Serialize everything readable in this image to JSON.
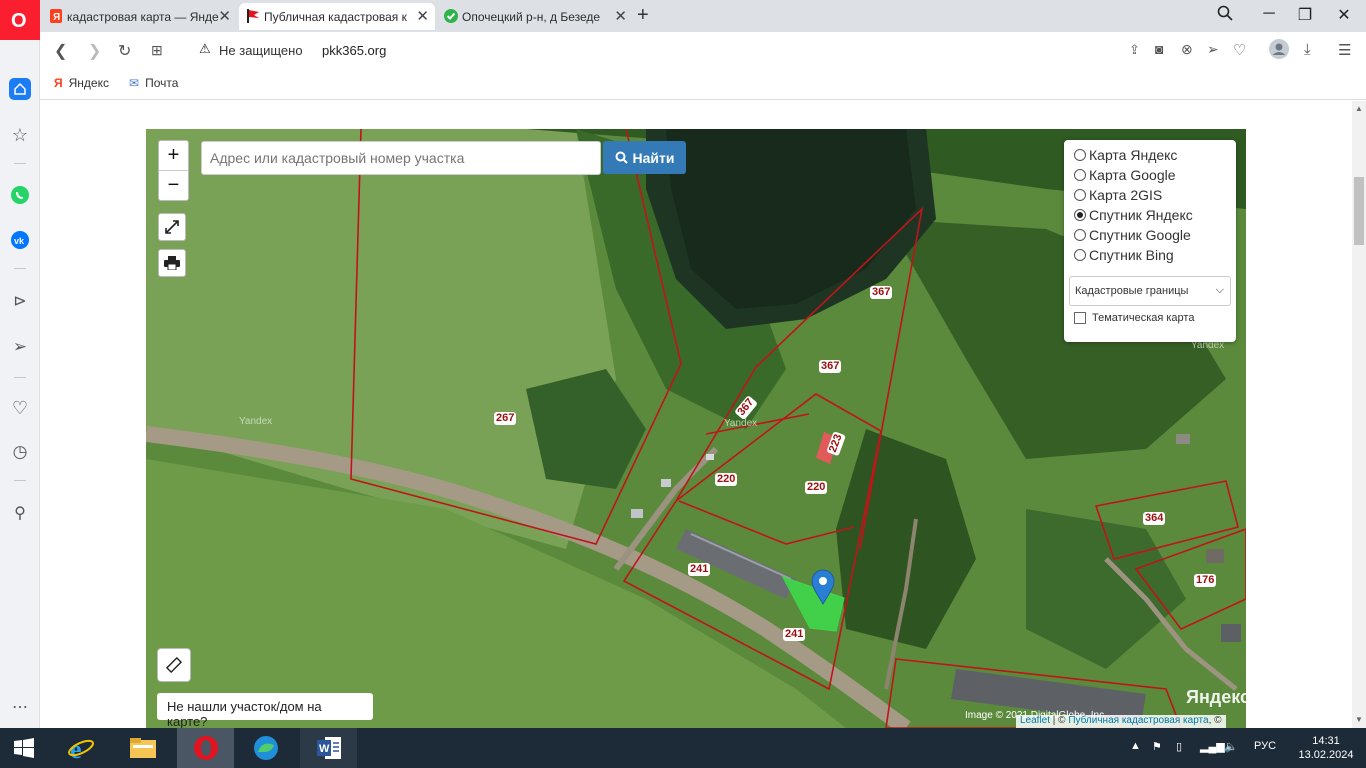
{
  "browser": {
    "tabs": [
      {
        "title": "кадастровая карта — Янде",
        "favicon": "yandex-icon"
      },
      {
        "title": "Публичная кадастровая к",
        "favicon": "flag-icon",
        "active": true
      },
      {
        "title": "Опочецкий р-н, д Безеде",
        "favicon": "check-icon"
      }
    ],
    "security_label": "Не защищено",
    "url": "pkk365.org",
    "bookmarks": [
      {
        "label": "Яндекс",
        "icon": "yandex-icon"
      },
      {
        "label": "Почта",
        "icon": "mail-icon"
      }
    ]
  },
  "map": {
    "search_placeholder": "Адрес или кадастровый номер участка",
    "search_button": "Найти",
    "zoom_in": "+",
    "zoom_out": "−",
    "base_layers": [
      {
        "label": "Карта Яндекс",
        "checked": false
      },
      {
        "label": "Карта Google",
        "checked": false
      },
      {
        "label": "Карта 2GIS",
        "checked": false
      },
      {
        "label": "Спутник Яндекс",
        "checked": true
      },
      {
        "label": "Спутник Google",
        "checked": false
      },
      {
        "label": "Спутник Bing",
        "checked": false
      }
    ],
    "overlay_select": "Кадастровые границы",
    "thematic_label": "Тематическая карта",
    "thematic_checked": false,
    "not_found_button": "Не нашли участок/дом на карте?",
    "parcel_labels": [
      "367",
      "367",
      "367",
      "267",
      "223",
      "220",
      "220",
      "241",
      "241",
      "364",
      "176"
    ],
    "watermark": "Yandex",
    "yandex_logo": "Яндекс",
    "attribution_image": "Image © 2021 DigitalGlobe, Inc.",
    "attribution_leaflet": "Leaflet",
    "attribution_sep": " | © ",
    "attribution_pkk": "Публичная кадастровая карта",
    "attribution_end": ", ©"
  },
  "taskbar": {
    "lang": "РУС",
    "time": "14:31",
    "date": "13.02.2024"
  },
  "colors": {
    "accent": "#337ab7",
    "brand": "#fa1e2f",
    "parcel_border": "#c0141a",
    "selected_parcel": "#3fd64a",
    "marker": "#2a7fd4"
  }
}
